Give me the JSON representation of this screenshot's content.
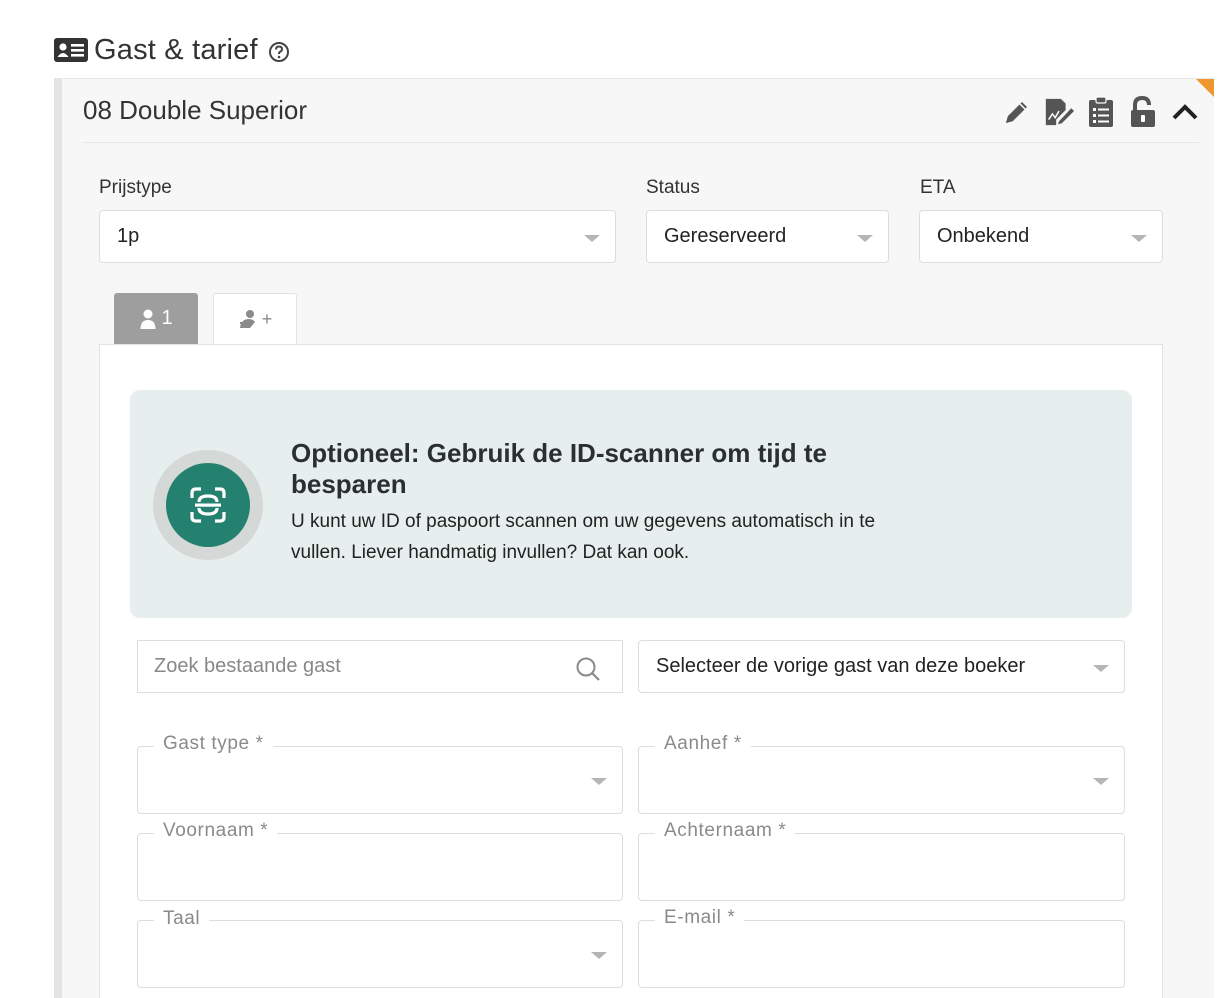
{
  "header": {
    "title": "Gast & tarief",
    "card_icon": "id-card-icon",
    "help_icon": "question-circle-icon"
  },
  "room": {
    "title": "08 Double Superior",
    "actions": [
      {
        "name": "edit-pencil-icon"
      },
      {
        "name": "signature-icon"
      },
      {
        "name": "clipboard-list-icon"
      },
      {
        "name": "unlock-icon"
      },
      {
        "name": "chevron-up-icon"
      }
    ]
  },
  "fields": {
    "prijstype": {
      "label": "Prijstype",
      "value": "1p"
    },
    "status": {
      "label": "Status",
      "value": "Gereserveerd"
    },
    "eta": {
      "label": "ETA",
      "value": "Onbekend"
    }
  },
  "tabs": {
    "guest_tab": "1",
    "add_tab": "+"
  },
  "scanner": {
    "title": "Optioneel: Gebruik de ID-scanner om tijd te besparen",
    "description": "U kunt uw ID of paspoort scannen om uw gegevens automatisch in te vullen. Liever handmatig invullen? Dat kan ook."
  },
  "search": {
    "placeholder": "Zoek bestaande gast"
  },
  "previous_guest": {
    "value": "Selecteer de vorige gast van deze boeker"
  },
  "form": {
    "gast_type": "Gast type *",
    "aanhef": "Aanhef *",
    "voornaam": "Voornaam *",
    "achternaam": "Achternaam *",
    "taal": "Taal",
    "email": "E-mail *"
  },
  "colors": {
    "accent": "#24806f",
    "card_bg": "#e7efee",
    "active_tab": "#9e9e9e",
    "flag": "#f0962e"
  }
}
